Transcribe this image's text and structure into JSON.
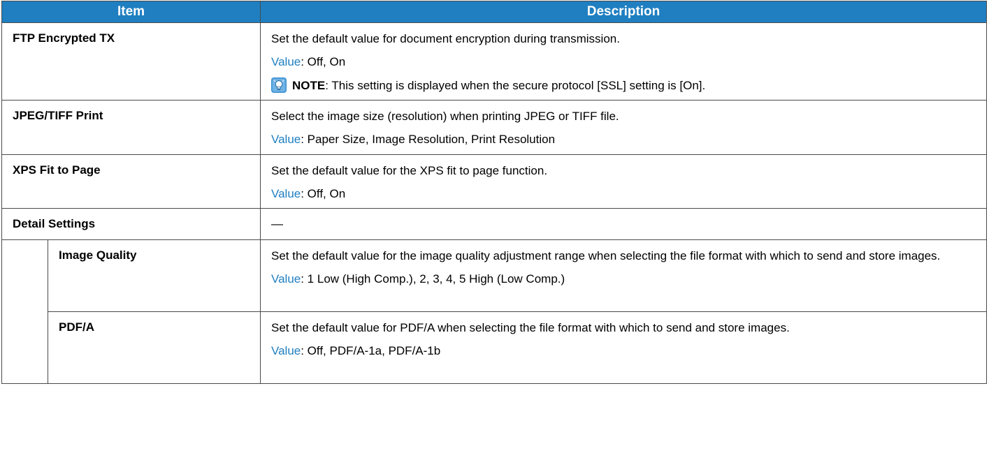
{
  "table": {
    "headers": {
      "item": "Item",
      "description": "Description"
    },
    "rows": [
      {
        "item": "FTP Encrypted TX",
        "description": "Set the default value for document encryption during transmission.",
        "value_label": "Value",
        "value_text": ": Off, On",
        "note_label": "NOTE",
        "note_text": ": This setting is displayed when the secure protocol [SSL] setting is [On]."
      },
      {
        "item": "JPEG/TIFF Print",
        "description": "Select the image size (resolution) when printing JPEG or TIFF file.",
        "value_label": "Value",
        "value_text": ": Paper Size, Image Resolution, Print Resolution"
      },
      {
        "item": "XPS Fit to Page",
        "description": "Set the default value for the XPS fit to page function.",
        "value_label": "Value",
        "value_text": ": Off, On"
      },
      {
        "item": "Detail Settings",
        "description": "—"
      }
    ],
    "sub_rows": [
      {
        "item": "Image Quality",
        "description": "Set the default value for the image quality adjustment range when selecting the file format with which to send and store images.",
        "value_label": "Value",
        "value_text": ": 1 Low (High Comp.), 2, 3, 4, 5 High (Low Comp.)"
      },
      {
        "item": "PDF/A",
        "description": "Set the default value for PDF/A when selecting the file format with which to send and store images.",
        "value_label": "Value",
        "value_text": ": Off, PDF/A-1a, PDF/A-1b"
      }
    ]
  },
  "colors": {
    "header_bg": "#1f7fc1",
    "value_label": "#1f7fc1",
    "note_icon": "#3a8fd0"
  },
  "icons": {
    "note": "note-lightbulb-icon"
  }
}
